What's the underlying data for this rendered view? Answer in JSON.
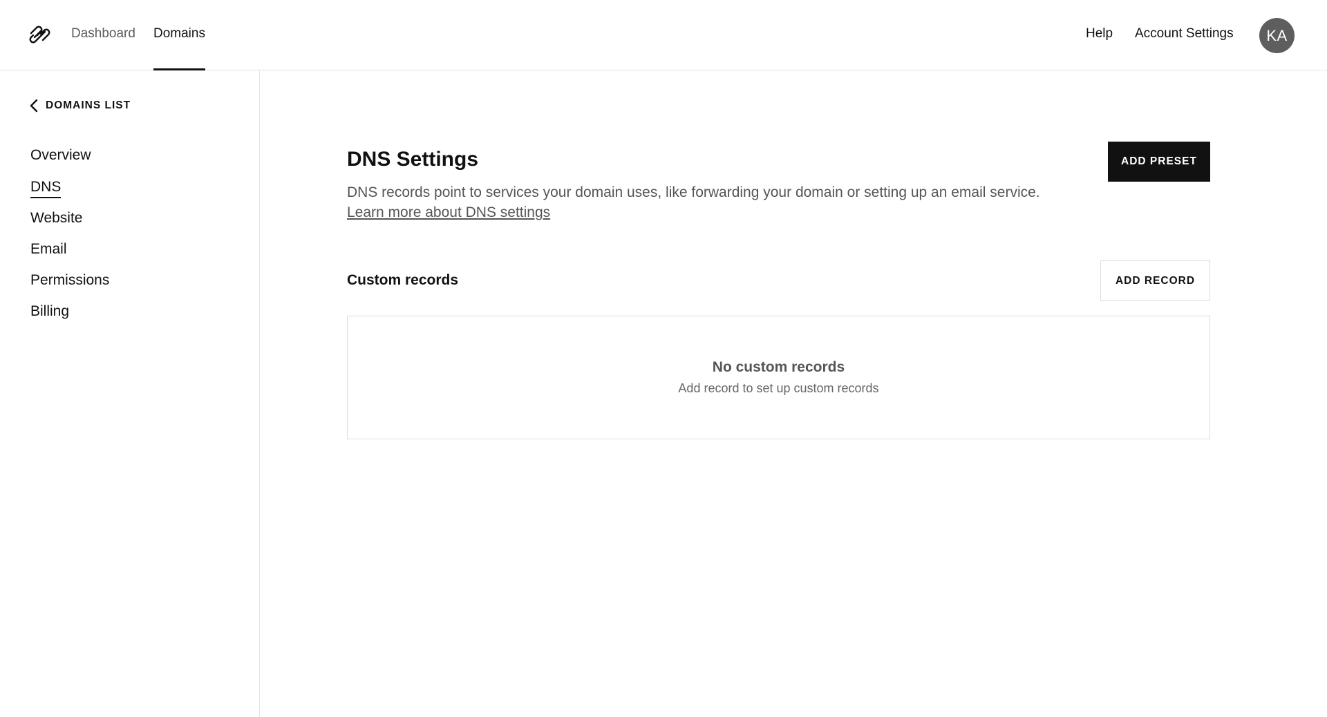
{
  "topbar": {
    "logo_icon": "squarespace-logo-icon",
    "tabs": [
      {
        "label": "Dashboard",
        "active": false
      },
      {
        "label": "Domains",
        "active": true
      }
    ],
    "help_label": "Help",
    "account_settings_label": "Account Settings",
    "avatar_initials": "KA"
  },
  "sidebar": {
    "back_label": "DOMAINS LIST",
    "back_icon": "chevron-left-icon",
    "items": [
      {
        "label": "Overview",
        "active": false
      },
      {
        "label": "DNS",
        "active": true
      },
      {
        "label": "Website",
        "active": false
      },
      {
        "label": "Email",
        "active": false
      },
      {
        "label": "Permissions",
        "active": false
      },
      {
        "label": "Billing",
        "active": false
      }
    ]
  },
  "main": {
    "title": "DNS Settings",
    "description": "DNS records point to services your domain uses, like forwarding your domain or setting up an email service.",
    "learn_more_label": "Learn more about DNS settings",
    "add_preset_label": "ADD PRESET",
    "custom_records_title": "Custom records",
    "add_record_label": "ADD RECORD",
    "empty_title": "No custom records",
    "empty_subtitle": "Add record to set up custom records"
  },
  "colors": {
    "primary_button": "#111111",
    "divider": "#e3e3e3",
    "avatar": "#5e5e5e"
  }
}
